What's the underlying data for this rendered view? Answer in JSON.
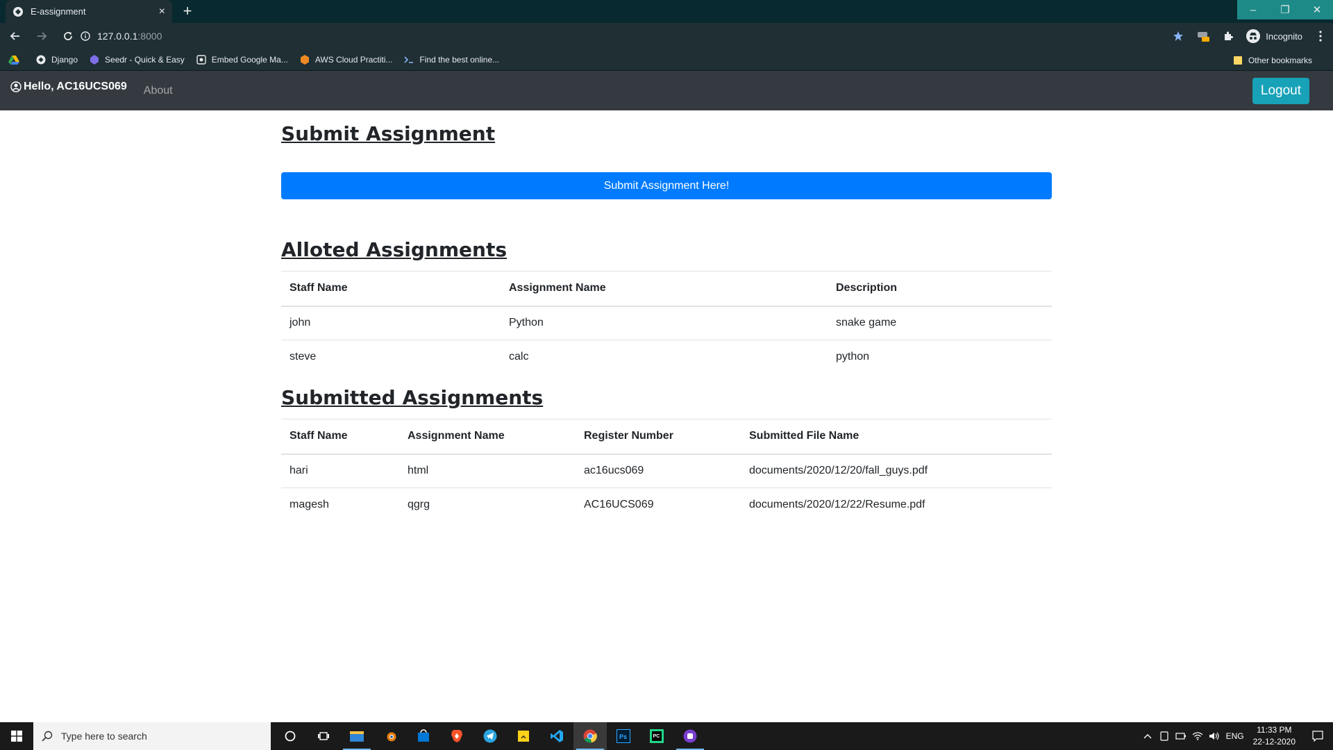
{
  "browser": {
    "tab_title": "E-assignment",
    "new_tab": "+",
    "close_tab": "×",
    "url_host": "127.0.0.1",
    "url_port": ":8000",
    "profile_label": "Incognito",
    "bookmarks": [
      {
        "label": "Django",
        "icon": "django-icon"
      },
      {
        "label": "Seedr - Quick & Easy",
        "icon": "seedr-icon"
      },
      {
        "label": "Embed Google Ma...",
        "icon": "maps-embed-icon"
      },
      {
        "label": "AWS Cloud Practiti...",
        "icon": "aws-icon"
      },
      {
        "label": "Find the best online...",
        "icon": "terminal-icon"
      }
    ],
    "other_bookmarks": "Other bookmarks",
    "window_controls": {
      "minimize": "–",
      "restore": "❐",
      "close": "✕"
    }
  },
  "navbar": {
    "greeting": "Hello, AC16UCS069",
    "about": "About",
    "logout": "Logout"
  },
  "submit_section": {
    "title": "Submit Assignment",
    "button": "Submit Assignment Here!"
  },
  "alloted": {
    "title": "Alloted Assignments",
    "headers": [
      "Staff Name",
      "Assignment Name",
      "Description"
    ],
    "rows": [
      [
        "john",
        "Python",
        "snake game"
      ],
      [
        "steve",
        "calc",
        "python"
      ]
    ]
  },
  "submitted": {
    "title": "Submitted Assignments",
    "headers": [
      "Staff Name",
      "Assignment Name",
      "Register Number",
      "Submitted File Name"
    ],
    "rows": [
      [
        "hari",
        "html",
        "ac16ucs069",
        "documents/2020/12/20/fall_guys.pdf"
      ],
      [
        "magesh",
        "qgrg",
        "AC16UCS069",
        "documents/2020/12/22/Resume.pdf"
      ]
    ]
  },
  "taskbar": {
    "search_placeholder": "Type here to search",
    "language": "ENG",
    "time": "11:33 PM",
    "date": "22-12-2020",
    "accent": "#76b9ed"
  },
  "colors": {
    "navbar_bg": "#343a40",
    "primary": "#007bff",
    "info": "#17a2b8",
    "browser_frame": "#1f2f33"
  }
}
